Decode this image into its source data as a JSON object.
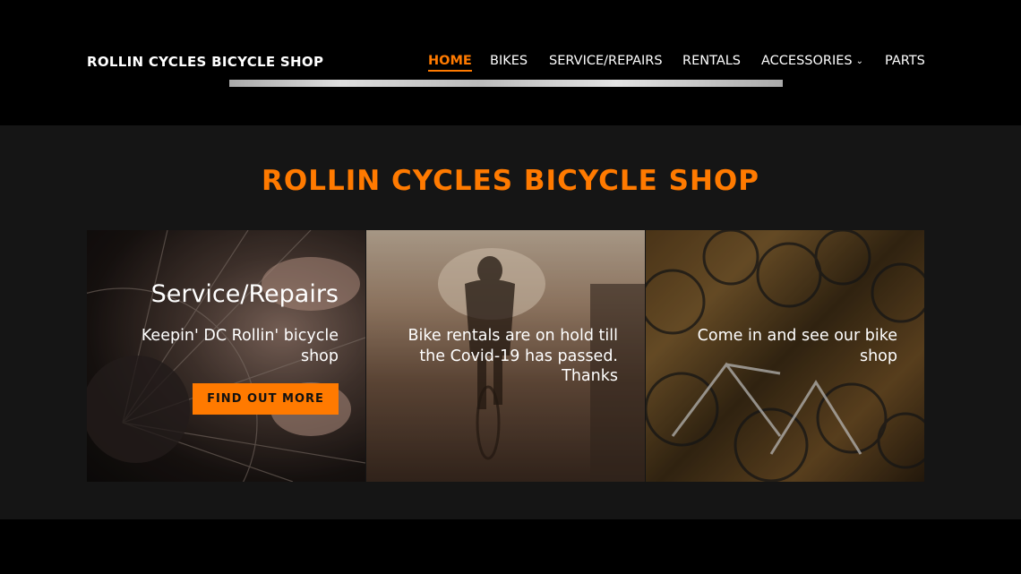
{
  "header": {
    "brand": "ROLLIN CYCLES BICYCLE SHOP",
    "nav": {
      "home": "HOME",
      "bikes": "BIKES",
      "service": "SERVICE/REPAIRS",
      "rentals": "RENTALS",
      "accessories": "ACCESSORIES",
      "parts": "PARTS"
    },
    "active_item": "home"
  },
  "main": {
    "title": "ROLLIN CYCLES BICYCLE SHOP",
    "cards": [
      {
        "title": "Service/Repairs",
        "text": "Keepin' DC Rollin' bicycle shop",
        "button_label": "FIND OUT MORE"
      },
      {
        "text": "Bike rentals are on hold till the Covid-19 has passed. Thanks"
      },
      {
        "text": "Come in and see our bike shop"
      }
    ]
  },
  "colors": {
    "accent": "#ff7a00",
    "background": "#000000",
    "section_background": "#151515",
    "text": "#ffffff"
  },
  "icons": {
    "accessories_dropdown": "chevron-down-icon"
  }
}
